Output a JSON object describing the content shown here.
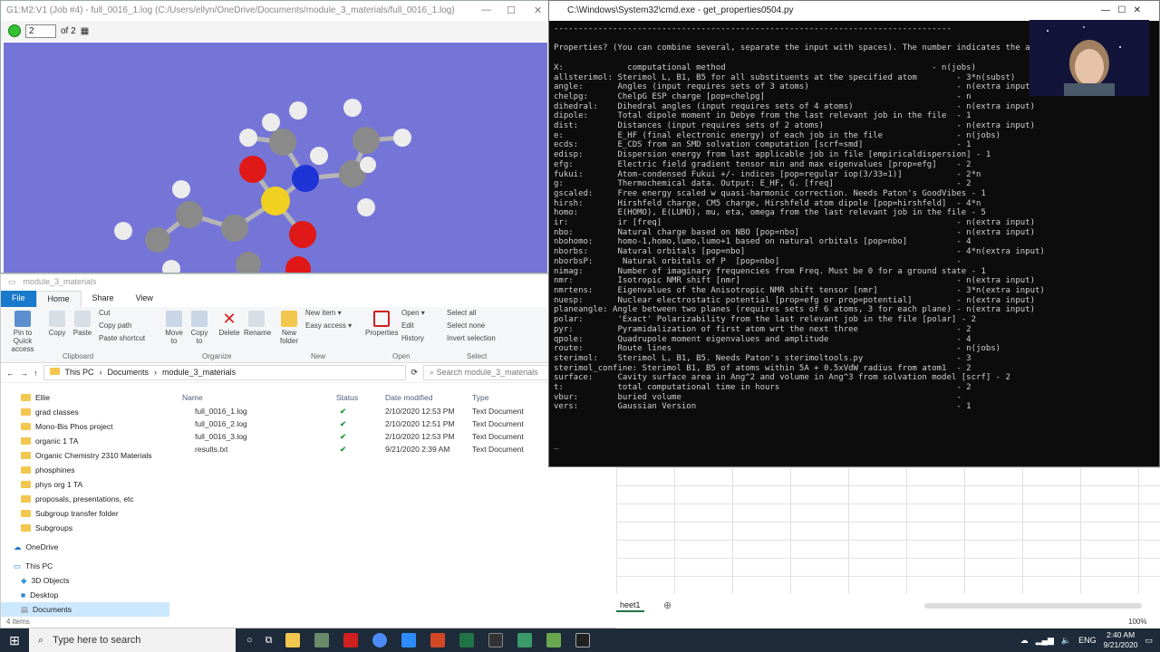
{
  "gaussview": {
    "title": "G1:M2:V1 (Job #4) - full_0016_1.log (C:/Users/ellyn/OneDrive/Documents/module_3_materials/full_0016_1.log)",
    "frame_value": "2",
    "frame_total": "of 2"
  },
  "explorer": {
    "title": "module_3_materials",
    "tabs": [
      "File",
      "Home",
      "Share",
      "View"
    ],
    "ribbon": {
      "pin": "Pin to Quick access",
      "copy": "Copy",
      "paste": "Paste",
      "cut": "Cut",
      "copy_path": "Copy path",
      "paste_shortcut": "Paste shortcut",
      "move_to": "Move to",
      "copy_to": "Copy to",
      "delete": "Delete",
      "rename": "Rename",
      "new_folder": "New folder",
      "new_item": "New item",
      "easy_access": "Easy access",
      "properties": "Properties",
      "open": "Open",
      "edit": "Edit",
      "history": "History",
      "select_all": "Select all",
      "select_none": "Select none",
      "invert_selection": "Invert selection",
      "groups": [
        "Clipboard",
        "Organize",
        "New",
        "Open",
        "Select"
      ]
    },
    "breadcrumb": [
      "This PC",
      "Documents",
      "module_3_materials"
    ],
    "search_placeholder": "Search module_3_materials",
    "nav": [
      "Ellie",
      "grad classes",
      "Mono-Bis Phos project",
      "organic 1 TA",
      "Organic Chemistry 2310 Materials",
      "phosphines",
      "phys org 1 TA",
      "proposals, presentations, etc",
      "Subgroup transfer folder",
      "Subgroups",
      "OneDrive",
      "This PC",
      "3D Objects",
      "Desktop",
      "Documents"
    ],
    "columns": [
      "Name",
      "Status",
      "Date modified",
      "Type"
    ],
    "files": [
      {
        "name": "full_0016_1.log",
        "date": "2/10/2020 12:53 PM",
        "type": "Text Document"
      },
      {
        "name": "full_0016_2.log",
        "date": "2/10/2020 12:51 PM",
        "type": "Text Document"
      },
      {
        "name": "full_0016_3.log",
        "date": "2/10/2020 12:53 PM",
        "type": "Text Document"
      },
      {
        "name": "results.txt",
        "date": "9/21/2020 2:39 AM",
        "type": "Text Document"
      }
    ],
    "status": "4 items"
  },
  "cmd": {
    "title": "C:\\Windows\\System32\\cmd.exe - get_properties0504.py",
    "lines": [
      "---------------------------------------------------------------------------------",
      "",
      "Properties? (You can combine several, separate the input with spaces). The number indicates the a",
      "",
      "X:             computational method                                          - n(jobs)",
      "allsterimol: Sterimol L, B1, B5 for all substituents at the specified atom        - 3*n(subst)",
      "angle:       Angles (input requires sets of 3 atoms)                              - n(extra input)",
      "chelpg:      ChelpG ESP charge [pop=chelpg]                                       - n",
      "dihedral:    Dihedral angles (input requires sets of 4 atoms)                     - n(extra input)",
      "dipole:      Total dipole moment in Debye from the last relevant job in the file  - 1",
      "dist:        Distances (input requires sets of 2 atoms)                           - n(extra input)",
      "e:           E_HF (final electronic energy) of each job in the file               - n(jobs)",
      "ecds:        E_CDS from an SMD solvation computation [scrf=smd]                   - 1",
      "edisp:       Dispersion energy from last applicable job in file [empiricaldispersion] - 1",
      "efg:         Electric field gradient tensor min and max eigenvalues [prop=efg]    - 2",
      "fukui:       Atom-condensed Fukui +/- indices [pop=regular iop(3/33=1)]           - 2*n",
      "g:           Thermochemical data. Output: E_HF, G. [freq]                         - 2",
      "gscaled:     Free energy scaled w quasi-harmonic correction. Needs Paton's GoodVibes - 1",
      "hirsh:       Hirshfeld charge, CM5 charge, Hirshfeld atom dipole [pop=hirshfeld]  - 4*n",
      "homo:        E(HOMO), E(LUMO), mu, eta, omega from the last relevant job in the file - 5",
      "ir:          ir [freq]                                                            - n(extra input)",
      "nbo:         Natural charge based on NBO [pop=nbo]                                - n(extra input)",
      "nbohomo:     homo-1,homo,lumo,lumo+1 based on natural orbitals [pop=nbo]          - 4",
      "nborbs:      Natural orbitals [pop=nbo]                                           - 4*n(extra input)",
      "nborbsP:      Natural orbitals of P  [pop=nbo]                                    -",
      "nimag:       Number of imaginary frequencies from Freq. Must be 0 for a ground state - 1",
      "nmr:         Isotropic NMR shift [nmr]                                            - n(extra input)",
      "nmrtens:     Eigenvalues of the Anisotropic NMR shift tensor [nmr]                - 3*n(extra input)",
      "nuesp:       Nuclear electrostatic potential [prop=efg or prop=potential]         - n(extra input)",
      "planeangle: Angle between two planes (requires sets of 6 atoms, 3 for each plane) - n(extra input)",
      "polar:       'Exact' Polarizability from the last relevant job in the file [polar] - 2",
      "pyr:         Pyramidalization of first atom wrt the next three                    - 2",
      "qpole:       Quadrupole moment eigenvalues and amplitude                          - 4",
      "route:       Route lines                                                          - n(jobs)",
      "sterimol:    Sterimol L, B1, B5. Needs Paton's sterimoltools.py                   - 3",
      "sterimol_confine: Sterimol B1, B5 of atoms within 5A + 0.5xVdW radius from atom1  - 2",
      "surface:     Cavity surface area in Ang^2 and volume in Ang^3 from solvation model [scrf] - 2",
      "t:           total computational time in hours                                    - 2",
      "vbur:        buried volume                                                        -",
      "vers:        Gaussian Version                                                     - 1",
      "",
      "",
      "",
      "_"
    ]
  },
  "excel": {
    "sheet_tab": "heet1",
    "zoom": "100%"
  },
  "taskbar": {
    "search_placeholder": "Type here to search",
    "lang": "ENG",
    "time": "2:40 AM",
    "date": "9/21/2020"
  }
}
